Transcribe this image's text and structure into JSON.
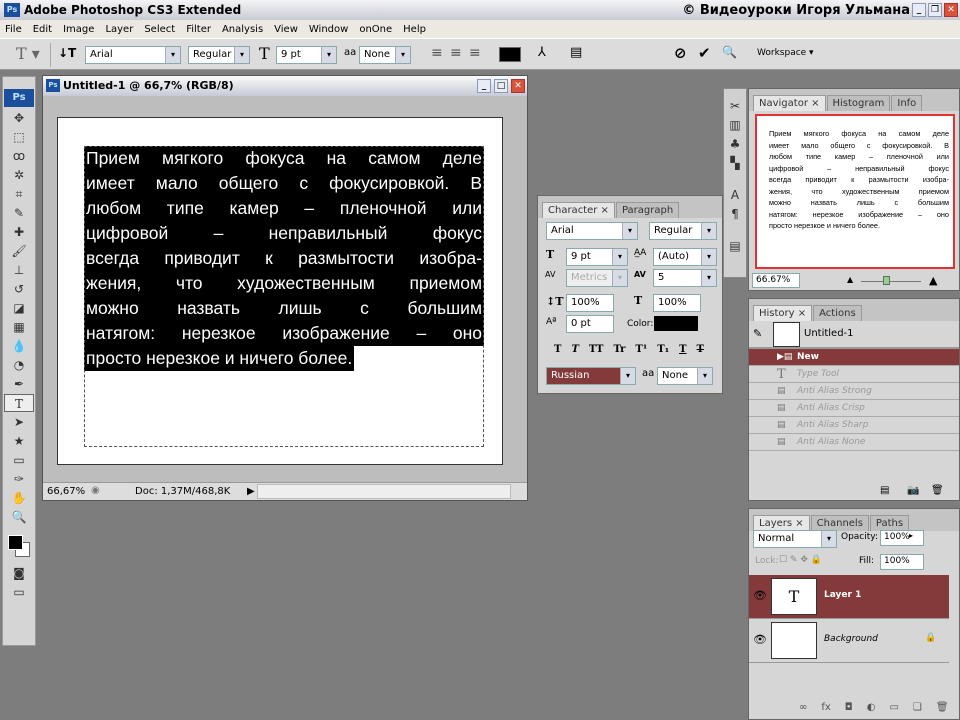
{
  "app": {
    "title": "Adobe Photoshop CS3 Extended",
    "watermark": "© Видеоуроки Игоря Ульмана",
    "logo": "Ps"
  },
  "menu": [
    "File",
    "Edit",
    "Image",
    "Layer",
    "Select",
    "Filter",
    "Analysis",
    "View",
    "Window",
    "onOne",
    "Help"
  ],
  "options": {
    "font": "Arial",
    "style": "Regular",
    "size": "9 pt",
    "antialias": "None",
    "antialias_label": "aa",
    "workspace": "Workspace ▾",
    "text_color": "#000000"
  },
  "document": {
    "title": "Untitled-1 @ 66,7% (RGB/8)",
    "zoom": "66,67%",
    "doc_info": "Doc: 1,37M/468,8K",
    "lines": [
      "Прием мягкого фокуса на самом деле",
      "имеет мало общего с фокусировкой. В",
      "любом типе камер – пленочной или",
      "цифровой – неправильный фокус",
      "всегда приводит к размытости изобра-",
      "жения, что художественным приемом",
      "можно назвать лишь с большим",
      "натягом: нерезкое изображение – оно",
      "просто нерезкое и ничего более."
    ]
  },
  "character": {
    "tabs": [
      "Character",
      "Paragraph"
    ],
    "font": "Arial",
    "style": "Regular",
    "size": "9 pt",
    "leading": "(Auto)",
    "kerning": "Metrics",
    "tracking": "5",
    "vscale": "100%",
    "hscale": "100%",
    "baseline": "0 pt",
    "color_label": "Color:",
    "language": "Russian",
    "antialias": "None",
    "styles": [
      "T",
      "T",
      "TT",
      "Tr",
      "T¹",
      "T₁",
      "T",
      "T"
    ]
  },
  "navigator": {
    "tabs": [
      "Navigator",
      "Histogram",
      "Info"
    ],
    "zoom": "66.67%"
  },
  "history": {
    "tabs": [
      "History",
      "Actions"
    ],
    "snapshot": "Untitled-1",
    "items": [
      "New",
      "Type Tool",
      "Anti Alias Strong",
      "Anti Alias Crisp",
      "Anti Alias Sharp",
      "Anti Alias None"
    ]
  },
  "layers": {
    "tabs": [
      "Layers",
      "Channels",
      "Paths"
    ],
    "blend": "Normal",
    "opacity_label": "Opacity:",
    "opacity": "100%",
    "lock_label": "Lock:",
    "fill_label": "Fill:",
    "fill": "100%",
    "items": [
      {
        "name": "Layer 1",
        "thumb": "T"
      },
      {
        "name": "Background",
        "thumb": ""
      }
    ]
  },
  "accent": "#843a3a"
}
